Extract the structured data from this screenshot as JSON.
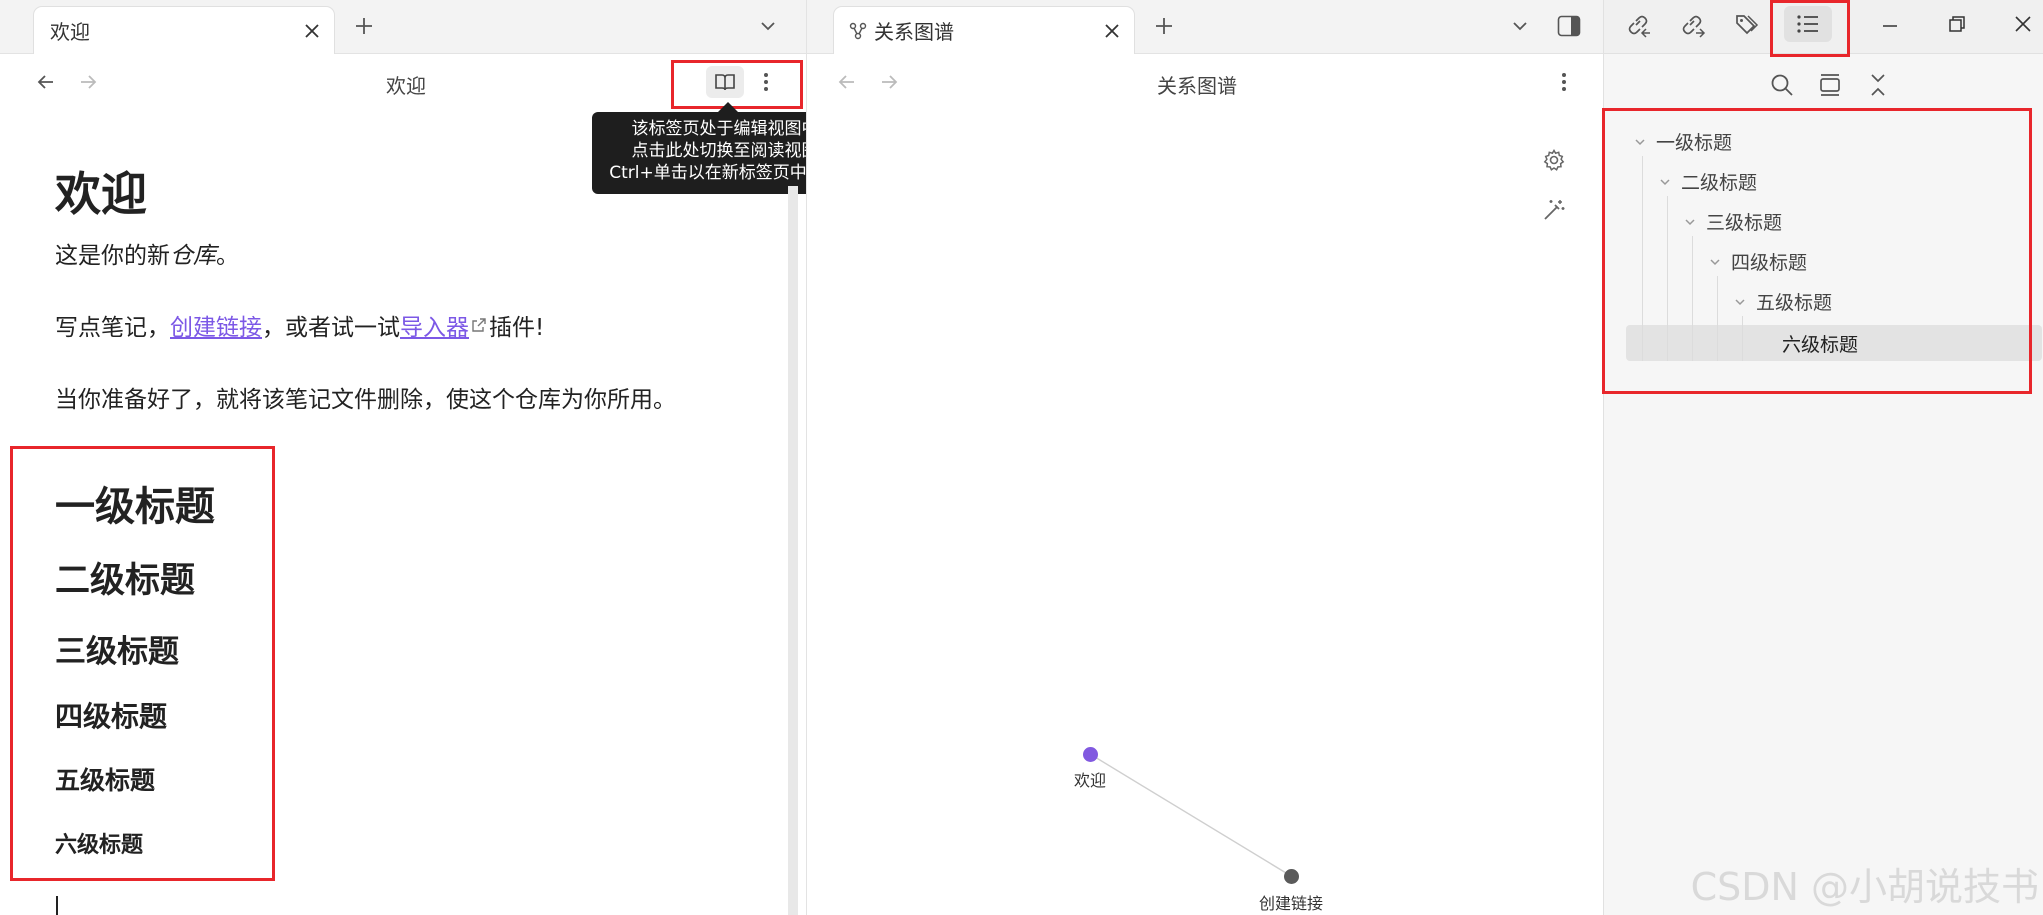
{
  "left_pane": {
    "tab": {
      "label": "欢迎"
    },
    "header": {
      "title": "欢迎"
    },
    "tooltip": {
      "line1": "该标签页处于编辑视图中",
      "line2": "点击此处切换至阅读视图",
      "line3": "Ctrl+单击以在新标签页中打开"
    },
    "doc": {
      "h1_title": "欢迎",
      "p1": "这是你的新",
      "p1_em": "仓库",
      "p1_end": "。",
      "p2_a": "写点笔记，",
      "p2_link1": "创建链接",
      "p2_b": "，或者试一试",
      "p2_link2": "导入器",
      "p2_c": "插件!",
      "p3": "当你准备好了，就将该笔记文件删除，使这个仓库为你所用。",
      "headings": [
        "一级标题",
        "二级标题",
        "三级标题",
        "四级标题",
        "五级标题",
        "六级标题"
      ]
    }
  },
  "mid_pane": {
    "tab": {
      "label": "关系图谱"
    },
    "header": {
      "title": "关系图谱"
    },
    "graph": {
      "nodes": [
        {
          "label": "欢迎",
          "color": "#8159e0"
        },
        {
          "label": "创建链接",
          "color": "#5a5a5a"
        }
      ]
    }
  },
  "right_pane": {
    "outline": [
      "一级标题",
      "二级标题",
      "三级标题",
      "四级标题",
      "五级标题",
      "六级标题"
    ]
  },
  "watermark": "CSDN @小胡说技书",
  "colors": {
    "accent": "#7c58e6",
    "highlight": "#e8262b"
  }
}
